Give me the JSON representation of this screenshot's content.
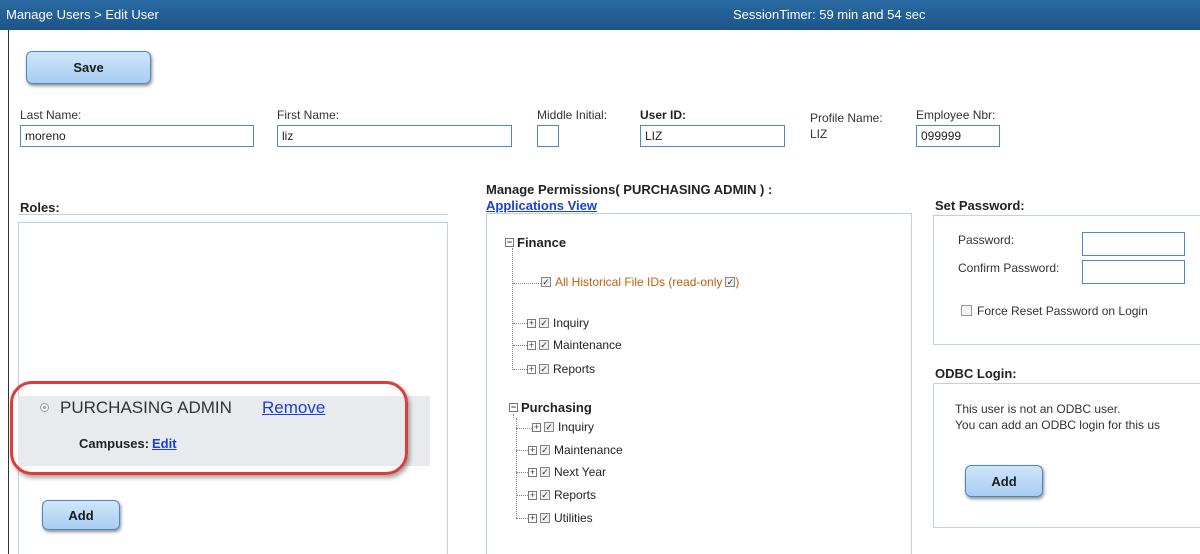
{
  "header": {
    "breadcrumb": "Manage Users > Edit User",
    "session_timer": "SessionTimer: 59 min and 54 sec"
  },
  "toolbar": {
    "save_label": "Save"
  },
  "user_form": {
    "last_name_label": "Last Name:",
    "last_name_value": "moreno",
    "first_name_label": "First Name:",
    "first_name_value": "liz",
    "middle_initial_label": "Middle Initial:",
    "middle_initial_value": "",
    "user_id_label": "User ID:",
    "user_id_value": "LIZ",
    "profile_name_label": "Profile Name:",
    "profile_name_value": "LIZ",
    "employee_nbr_label": "Employee Nbr:",
    "employee_nbr_value": "099999"
  },
  "roles": {
    "title": "Roles:",
    "role_name": "PURCHASING ADMIN",
    "remove_label": "Remove",
    "campuses_label": "Campuses:",
    "edit_label": "Edit",
    "add_label": "Add"
  },
  "permissions": {
    "title": "Manage Permissions( PURCHASING ADMIN ) :",
    "view_link": "Applications View",
    "finance": {
      "label": "Finance",
      "historical": "All Historical File IDs (read-only",
      "historical_suffix": ")",
      "children": [
        "Inquiry",
        "Maintenance",
        "Reports"
      ]
    },
    "purchasing": {
      "label": "Purchasing",
      "children": [
        "Inquiry",
        "Maintenance",
        "Next Year",
        "Reports",
        "Utilities"
      ]
    }
  },
  "password": {
    "title": "Set Password:",
    "password_label": "Password:",
    "confirm_label": "Confirm Password:",
    "force_reset_label": "Force Reset Password on Login"
  },
  "odbc": {
    "title": "ODBC Login:",
    "line1": "This user is not an ODBC user.",
    "line2": "You can add an ODBC login for this us",
    "add_label": "Add"
  },
  "colors": {
    "header_bg": "#1d5489",
    "button_bg": "#a8cdf2",
    "highlight_circle": "#e03a3a",
    "link": "#1a3fd9",
    "permission_accent": "#c06010"
  }
}
